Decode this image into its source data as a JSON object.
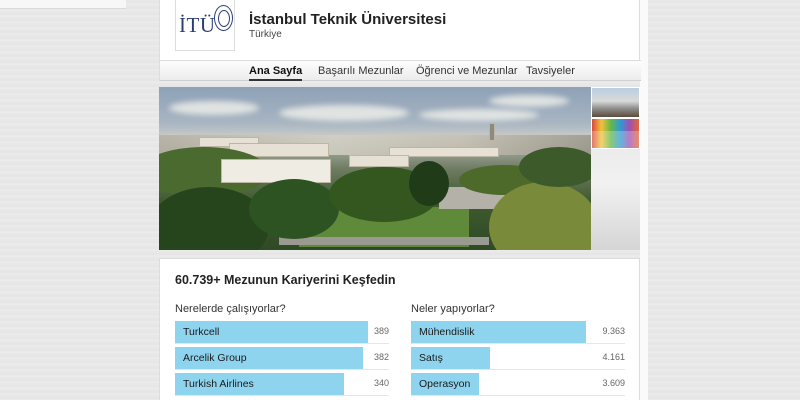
{
  "header": {
    "logo_text": "İTÜ",
    "org_name": "İstanbul Teknik Üniversitesi",
    "country": "Türkiye"
  },
  "tabs": [
    {
      "label": "Ana Sayfa",
      "active": true
    },
    {
      "label": "Başarılı Mezunlar",
      "active": false
    },
    {
      "label": "Öğrenci ve Mezunlar",
      "active": false
    },
    {
      "label": "Tavsiyeler",
      "active": false
    }
  ],
  "insights": {
    "title": "60.739+ Mezunun Kariyerini Keşfedin",
    "where": {
      "heading": "Nerelerde çalışıyorlar?",
      "bar_color": "#8fd4ef",
      "rows": [
        {
          "label": "Turkcell",
          "value": "389",
          "fill": 0.9
        },
        {
          "label": "Arcelik Group",
          "value": "382",
          "fill": 0.88
        },
        {
          "label": "Turkish Airlines",
          "value": "340",
          "fill": 0.79
        }
      ]
    },
    "what": {
      "heading": "Neler yapıyorlar?",
      "bar_color": "#8fd4ef",
      "rows": [
        {
          "label": "Mühendislik",
          "value": "9.363",
          "fill": 0.82
        },
        {
          "label": "Satış",
          "value": "4.161",
          "fill": 0.37
        },
        {
          "label": "Operasyon",
          "value": "3.609",
          "fill": 0.32
        }
      ]
    }
  }
}
